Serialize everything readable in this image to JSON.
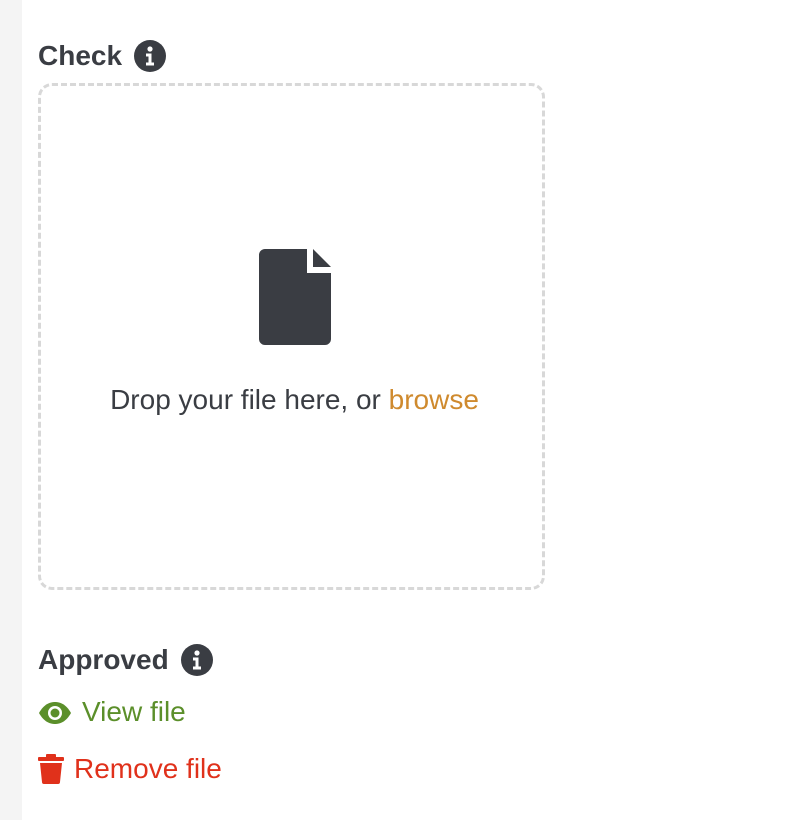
{
  "check_section": {
    "title": "Check",
    "info_icon": "info-icon"
  },
  "dropzone": {
    "icon": "file-icon",
    "prompt_text": "Drop your file here, or ",
    "browse_label": "browse"
  },
  "approved_section": {
    "title": "Approved",
    "info_icon": "info-icon"
  },
  "actions": {
    "view_label": "View file",
    "view_icon": "eye-icon",
    "remove_label": "Remove file",
    "remove_icon": "trash-icon"
  },
  "colors": {
    "text": "#3a3d43",
    "browse": "#cf8a2e",
    "view": "#5b8f2a",
    "remove": "#e0311b",
    "dropzone_border": "#d8d8d8"
  }
}
